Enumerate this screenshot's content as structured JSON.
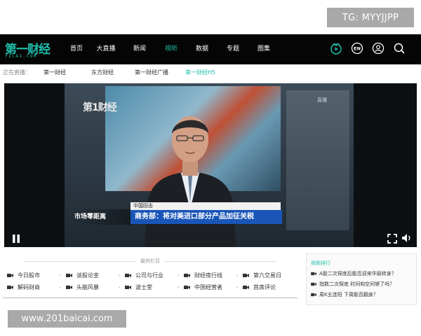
{
  "watermarks": {
    "top": "TG: MYYJJPP",
    "bottom": "www.201baicai.com"
  },
  "colors": {
    "accent": "#1fc0ad",
    "nav_bg": "#050505",
    "news_blue": "#1a56b8"
  },
  "header": {
    "logo_text": "第一财经",
    "logo_sub": "YICAI.COM",
    "menu": [
      {
        "label": "首页",
        "active": false
      },
      {
        "label": "大直播",
        "active": false
      },
      {
        "label": "新闻",
        "active": false
      },
      {
        "label": "视听",
        "active": true
      },
      {
        "label": "数据",
        "active": false
      },
      {
        "label": "专题",
        "active": false
      },
      {
        "label": "图集",
        "active": false
      }
    ],
    "icons": [
      "tv-icon",
      "language-icon",
      "user-icon",
      "search-icon"
    ],
    "lang_label": "EN"
  },
  "live": {
    "label": "正在直播：",
    "channels": [
      {
        "label": "第一财经",
        "active": false
      },
      {
        "label": "东方财经",
        "active": false
      },
      {
        "label": "第一财经广播",
        "active": false
      },
      {
        "label": "第一财经H5",
        "active": true
      }
    ]
  },
  "video": {
    "channel_logo": "第1财经",
    "corner_tag": "直播",
    "show_name": "市场零距离",
    "caption_top": "中国回击",
    "caption_main": "商务部：将对美进口部分产品加征关税"
  },
  "featured": {
    "title": "最热栏目",
    "items": [
      "今日股市",
      "谈股论金",
      "公司与行业",
      "财经夜行线",
      "第六交易日",
      "解码财商",
      "头脑风暴",
      "波士堂",
      "中国经营者",
      "首席评论"
    ]
  },
  "ranking": {
    "title": "视频排行",
    "items": [
      "A股二次探底后能否迎来华丽转身？",
      "指数二次探底 时间和空间够了吗？",
      "周K五连阳 下周能否翻身？"
    ]
  }
}
